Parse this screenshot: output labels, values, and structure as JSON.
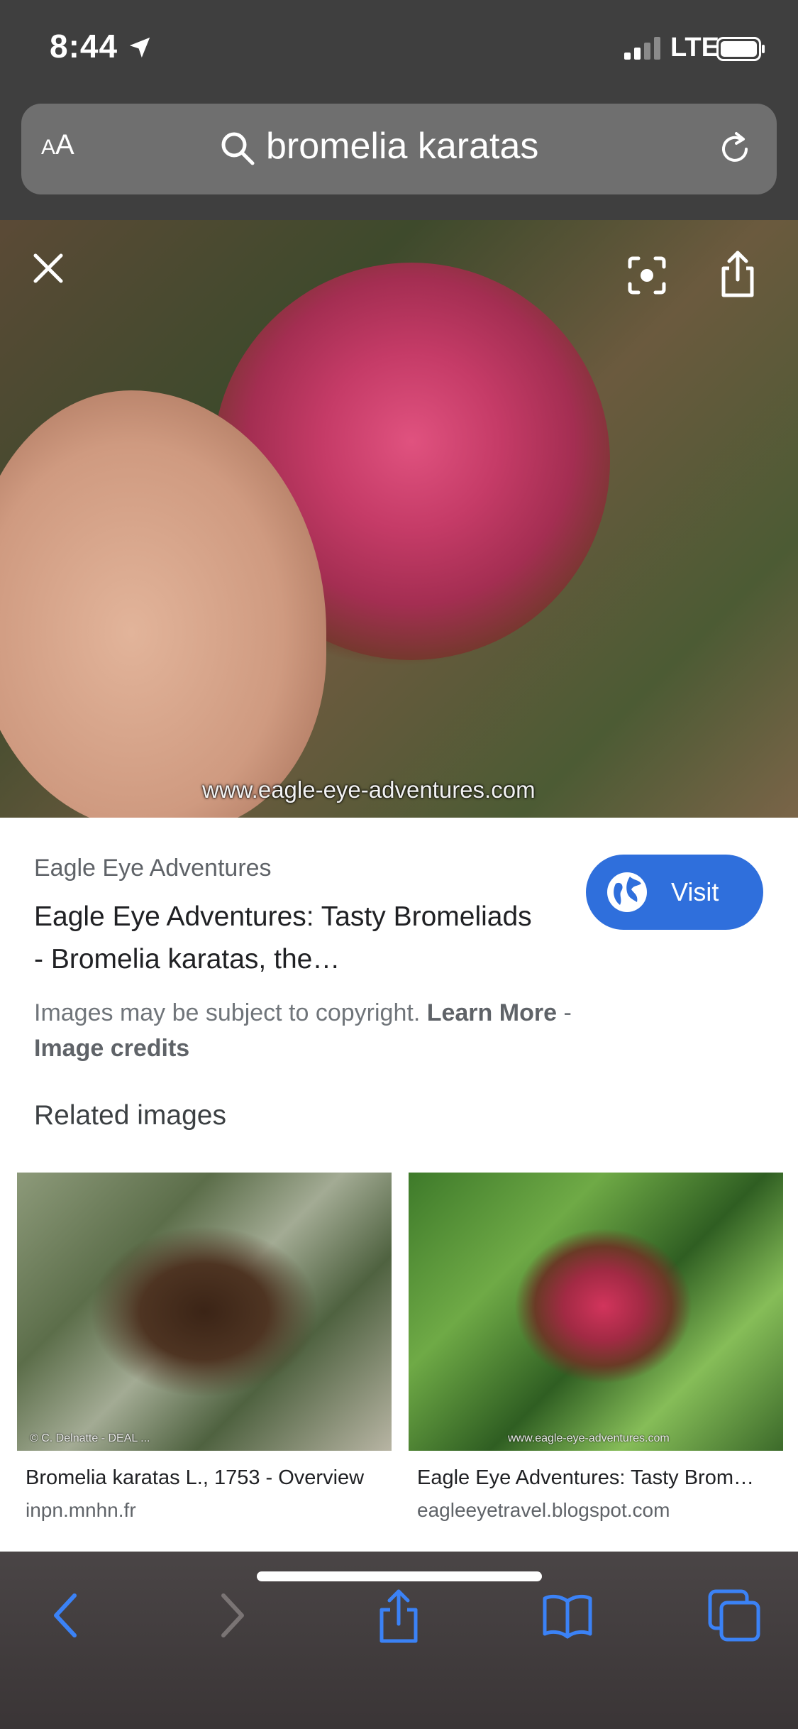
{
  "status_bar": {
    "time": "8:44",
    "network": "LTE"
  },
  "address_bar": {
    "aa_label_small": "A",
    "aa_label_large": "A",
    "query": "bromelia karatas"
  },
  "image_viewer": {
    "watermark": "www.eagle-eye-adventures.com"
  },
  "result": {
    "site_name": "Eagle Eye Adventures",
    "title": "Eagle Eye Adventures: Tasty Bromeliads - Bromelia karatas, the…",
    "visit_label": "Visit",
    "copyright_text": "Images may be subject to copyright.",
    "learn_more": "Learn More",
    "separator": "-",
    "image_credits": "Image credits"
  },
  "related": {
    "heading": "Related images",
    "items": [
      {
        "caption": "Bromelia karatas L., 1753 - Overview",
        "source": "inpn.mnhn.fr",
        "credit": "© C. Delnatte - DEAL ..."
      },
      {
        "caption": "Eagle Eye Adventures: Tasty Brom…",
        "source": "eagleeyetravel.blogspot.com",
        "credit": "www.eagle-eye-adventures.com"
      }
    ]
  },
  "colors": {
    "accent": "#2f6fdc",
    "toolbar_icon": "#3b82f6",
    "toolbar_icon_disabled": "#7a7474"
  },
  "icons": [
    "location-arrow-icon",
    "signal-icon",
    "battery-icon",
    "search-icon",
    "reload-icon",
    "close-icon",
    "lens-icon",
    "share-icon",
    "globe-icon",
    "back-icon",
    "forward-icon",
    "bookmarks-icon",
    "tabs-icon"
  ]
}
